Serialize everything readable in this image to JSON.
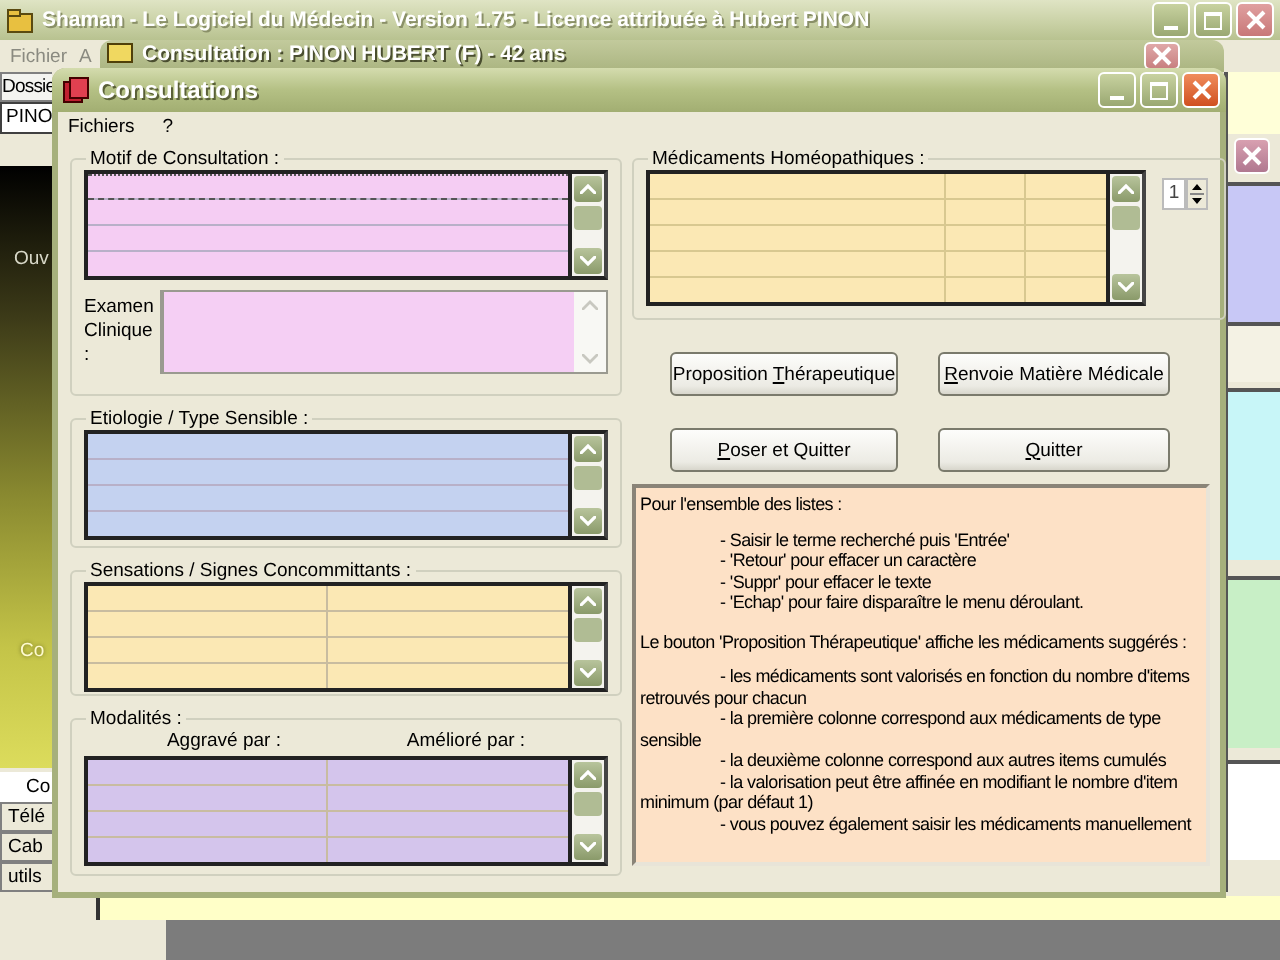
{
  "app_window": {
    "title": "Shaman - Le Logiciel du Médecin - Version 1.75 - Licence attribuée à Hubert PINON",
    "menu": [
      "Fichier",
      "A"
    ]
  },
  "side_panel": {
    "tab": "Dossie",
    "field_value": "PINO",
    "labels": [
      "Ouv",
      "Co"
    ],
    "tabs": [
      {
        "label": "Co",
        "selected": true
      },
      {
        "label": "Télé",
        "selected": false
      },
      {
        "label": "Cab",
        "selected": false
      },
      {
        "label": "utils",
        "selected": false
      }
    ]
  },
  "consultation_window": {
    "title": "Consultation : PINON HUBERT (F) - 42 ans"
  },
  "dialog": {
    "title": "Consultations",
    "menu": [
      "Fichiers",
      "?"
    ],
    "left_groups": [
      {
        "kind": "motif",
        "label": "Motif de Consultation :",
        "examen_label": "Examen Clinique :"
      },
      {
        "kind": "etiologie",
        "label": "Etiologie / Type Sensible :"
      },
      {
        "kind": "sensations",
        "label": "Sensations / Signes Concommittants :"
      },
      {
        "kind": "modalites",
        "label": "Modalités :",
        "columns": [
          "Aggravé par :",
          "Amélioré par :"
        ]
      }
    ],
    "medicaments": {
      "label": "Médicaments Homéopathiques :",
      "spinner_value": "1"
    },
    "buttons": [
      {
        "parts": [
          {
            "text": "Proposition ",
            "underlined": false
          },
          {
            "text": "T",
            "underlined": true
          },
          {
            "text": "hérapeutique",
            "underlined": false
          }
        ]
      },
      {
        "parts": [
          {
            "text": "R",
            "underlined": true
          },
          {
            "text": "envoie Matière Médicale",
            "underlined": false
          }
        ]
      },
      {
        "parts": [
          {
            "text": "P",
            "underlined": true
          },
          {
            "text": "oser et Quitter",
            "underlined": false
          }
        ]
      },
      {
        "parts": [
          {
            "text": "Q",
            "underlined": true
          },
          {
            "text": "uitter",
            "underlined": false
          }
        ]
      }
    ],
    "help": [
      {
        "kind": "heading",
        "text": "Pour l'ensemble des listes :"
      },
      {
        "kind": "item",
        "text": "- Saisir le terme recherché puis 'Entrée'"
      },
      {
        "kind": "item",
        "text": "- 'Retour' pour effacer un caractère"
      },
      {
        "kind": "item",
        "text": "- 'Suppr' pour effacer le texte"
      },
      {
        "kind": "item",
        "text": "- 'Echap' pour faire disparaître le menu déroulant."
      },
      {
        "kind": "heading",
        "text": "Le bouton 'Proposition Thérapeutique' affiche les médicaments suggérés :"
      },
      {
        "kind": "item",
        "text": "- les médicaments sont valorisés en fonction du nombre d'items retrouvés pour chacun"
      },
      {
        "kind": "item",
        "text": "- la première colonne correspond aux médicaments de type sensible"
      },
      {
        "kind": "item",
        "text": "- la deuxième colonne correspond aux autres items cumulés"
      },
      {
        "kind": "item",
        "text": "- la valorisation peut être affinée en modifiant le nombre d'item minimum (par défaut 1)"
      },
      {
        "kind": "item",
        "text": "- vous pouvez également saisir les médicaments manuellement"
      }
    ]
  }
}
